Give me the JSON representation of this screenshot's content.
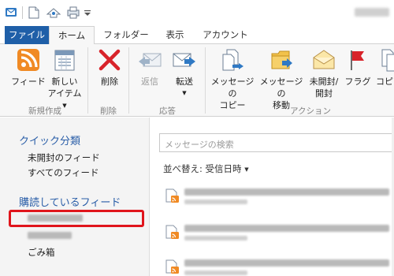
{
  "ribbon_tabs": {
    "file": "ファイル",
    "home": "ホーム",
    "folder": "フォルダー",
    "view": "表示",
    "account": "アカウント"
  },
  "ribbon": {
    "feed": "フィード",
    "new_item_line1": "新しい",
    "new_item_line2": "アイテム",
    "delete": "削除",
    "reply": "返信",
    "forward": "転送",
    "copy_line1": "メッセージの",
    "copy_line2": "コピー",
    "move_line1": "メッセージの",
    "move_line2": "移動",
    "unread_line1": "未開封/",
    "unread_line2": "開封",
    "flag": "フラグ",
    "copy_partial": "コピ",
    "group_new": "新規作成",
    "group_delete": "削除",
    "group_respond": "応答",
    "group_actions": "アクション"
  },
  "nav": {
    "quick_views_header": "クイック分類",
    "unread_feeds": "未開封のフィード",
    "all_feeds": "すべてのフィード",
    "subscribed_header": "購読しているフィード",
    "trash": "ごみ箱"
  },
  "list": {
    "search_placeholder": "メッセージの検索",
    "sort_label": "並べ替え: 受信日時"
  },
  "colors": {
    "file_tab": "#1f5fa8",
    "nav_header": "#2a5ea8",
    "highlight_box": "#e0151c",
    "rss_orange": "#f08a24"
  }
}
